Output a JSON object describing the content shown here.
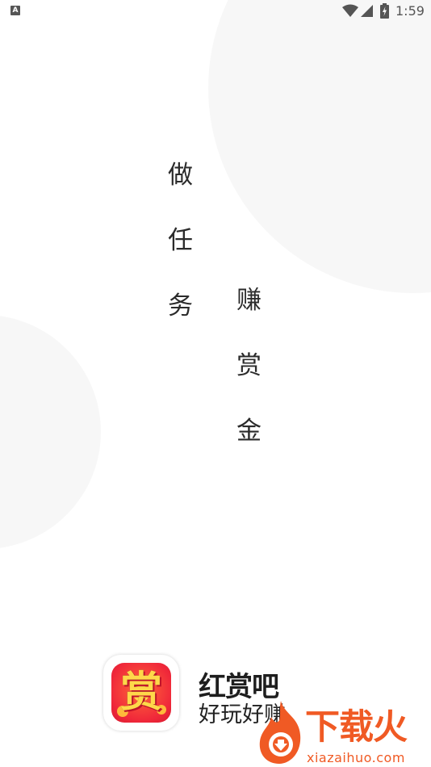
{
  "status_bar": {
    "notification_badge": "A",
    "time": "1:59",
    "icons": [
      "wifi-icon",
      "cell-signal-icon",
      "battery-charging-icon"
    ]
  },
  "slogan": {
    "column1": [
      "做",
      "任",
      "务"
    ],
    "column2": [
      "赚",
      "赏",
      "金"
    ]
  },
  "brand": {
    "logo_char": "赏",
    "app_name": "红赏吧",
    "tagline": "好玩好赚"
  },
  "watermark": {
    "title": "下载火",
    "url": "xiazaihuo.com"
  },
  "colors": {
    "background": "#ffffff",
    "circle": "#f7f7f7",
    "text": "#2b2b2b",
    "logo_red": "#f0283a",
    "logo_gold": "#ffd84a",
    "watermark_orange": "#f05a24"
  }
}
